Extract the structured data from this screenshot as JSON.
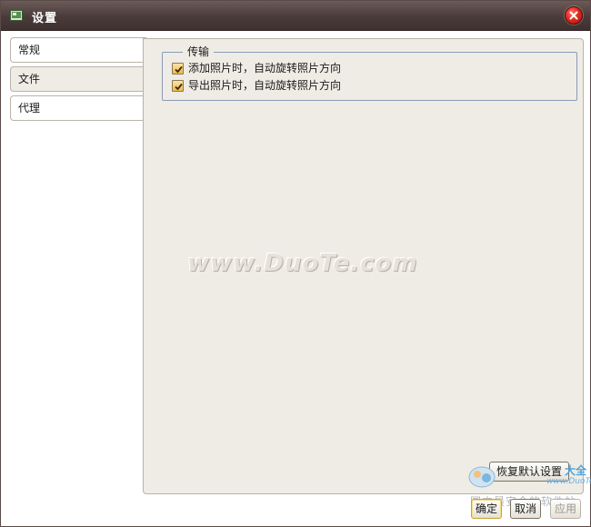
{
  "window": {
    "title": "设置"
  },
  "sidebar": {
    "items": [
      {
        "label": "常规",
        "selected": false
      },
      {
        "label": "文件",
        "selected": true
      },
      {
        "label": "代理",
        "selected": false
      }
    ]
  },
  "transfer_group": {
    "title": "传输",
    "options": [
      {
        "label": "添加照片时，自动旋转照片方向",
        "checked": true
      },
      {
        "label": "导出照片时，自动旋转照片方向",
        "checked": true
      }
    ]
  },
  "watermark": {
    "text": "www.DuoTe.com"
  },
  "buttons": {
    "restore_defaults": "恢复默认设置",
    "ok": "确定",
    "cancel": "取消",
    "apply": "应用"
  },
  "corner_logo": {
    "line1": "大全",
    "line2": "www.DuoTe.com",
    "line3": "国内最安全的软件站"
  },
  "colors": {
    "titlebar": "#4a3b3a",
    "panel_bg": "#efece5",
    "close_button": "#e02a1e",
    "checkbox": "#f0b94a"
  }
}
